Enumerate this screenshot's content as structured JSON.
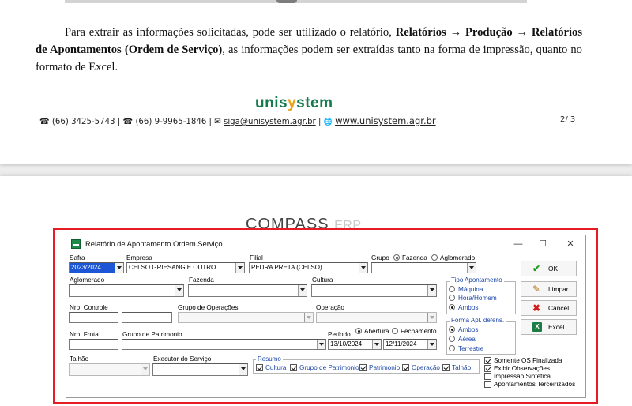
{
  "document": {
    "paragraph": {
      "part1": "Para extrair as informações solicitadas, pode ser utilizado o relatório, ",
      "path_bold": "Relatórios → Produção → Relatórios de Apontamentos (Ordem de Serviço)",
      "part2": ", as informações podem ser extraídas tanto na forma de impressão, quanto no formato de Excel."
    },
    "logo": {
      "left": "unis",
      "mid": "y",
      "right": "stem"
    },
    "footer": {
      "phone1": "☎ (66) 3425-5743 | ",
      "phone2": "☎ (66) 9-9965-1846 | ",
      "email_icon": "✉",
      "email": "siga@unisystem.agr.br",
      "sep": " | ",
      "web_icon": "🌐",
      "website": "www.unisystem.agr.br"
    },
    "page_number": "2/ 3",
    "watermark": {
      "main": "COMPASS",
      "suffix": "ERP"
    }
  },
  "dialog": {
    "title": "Relatório de Apontamento Ordem Serviço",
    "window_controls": {
      "minimize": "—",
      "maximize": "☐",
      "close": "✕"
    },
    "fields": {
      "safra": {
        "label": "Safra",
        "value": "2023/2024"
      },
      "empresa": {
        "label": "Empresa",
        "value": "CELSO GRIESANG E OUTRO"
      },
      "filial": {
        "label": "Filial",
        "value": "PEDRA PRETA (CELSO)"
      },
      "grupo": {
        "label": "Grupo",
        "options": [
          "Fazenda",
          "Aglomerado"
        ],
        "selected": "Fazenda",
        "value": ""
      },
      "aglomerado": {
        "label": "Aglomerado",
        "value": ""
      },
      "fazenda": {
        "label": "Fazenda",
        "value": ""
      },
      "cultura": {
        "label": "Cultura",
        "value": ""
      },
      "nro_controle": {
        "label": "Nro. Controle",
        "value": ""
      },
      "grupo_operacoes": {
        "label": "Grupo de Operações",
        "value": ""
      },
      "operacao": {
        "label": "Operação",
        "value": ""
      },
      "nro_frota": {
        "label": "Nro. Frota",
        "value": ""
      },
      "grupo_patrimonio": {
        "label": "Grupo de Patrimonio",
        "value": ""
      },
      "periodo": {
        "label": "Período",
        "options": [
          "Abertura",
          "Fechamento"
        ],
        "selected": "Abertura",
        "date_from": "13/10/2024",
        "date_to": "12/11/2024"
      },
      "talhao": {
        "label": "Talhão",
        "value": ""
      },
      "executor": {
        "label": "Executor do Serviço",
        "value": ""
      }
    },
    "tipo_apontamento": {
      "title": "Tipo Apontamento",
      "options": [
        "Máquina",
        "Hora/Homem",
        "Ambos"
      ],
      "selected": "Ambos"
    },
    "forma_aplicacao": {
      "title": "Forma Apl. defens.",
      "options": [
        "Ambos",
        "Aérea",
        "Terrestre"
      ],
      "selected": "Ambos"
    },
    "resumo": {
      "title": "Resumo",
      "items": [
        "Cultura",
        "Grupo de Patrimonio",
        "Patrimonio",
        "Operação",
        "Talhão"
      ],
      "checked": [
        true,
        true,
        true,
        true,
        true
      ]
    },
    "options": [
      {
        "label": "Somente OS Finalizada",
        "checked": true
      },
      {
        "label": "Exibir Observações",
        "checked": true
      },
      {
        "label": "Impressão Sintética",
        "checked": false
      },
      {
        "label": "Apontamentos Terceirizados",
        "checked": false
      }
    ],
    "buttons": {
      "ok": "OK",
      "limpar": "Limpar",
      "cancel": "Cancel",
      "excel": "Excel"
    }
  },
  "colors": {
    "highlight_frame": "#e51c23",
    "selection": "#1c56d6",
    "brand_green": "#137b4d",
    "brand_orange": "#e9a31e"
  }
}
